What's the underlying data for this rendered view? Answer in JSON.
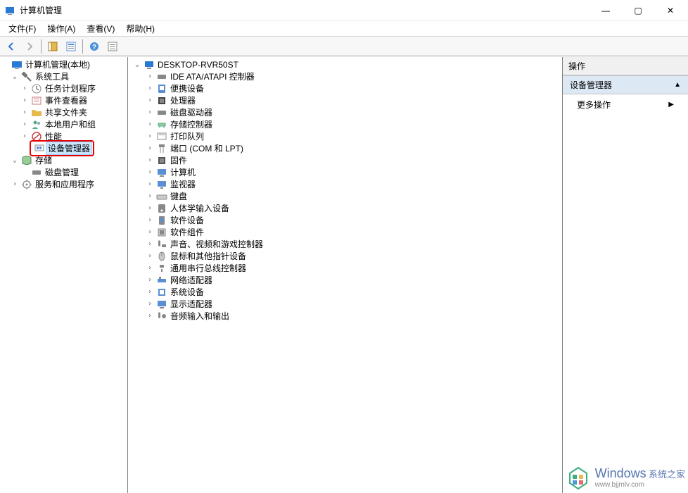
{
  "window": {
    "title": "计算机管理",
    "minimize": "—",
    "maximize": "▢",
    "close": "✕"
  },
  "menu": {
    "file": "文件(F)",
    "action": "操作(A)",
    "view": "查看(V)",
    "help": "帮助(H)"
  },
  "toolbar": {
    "back": "←",
    "forward": "→",
    "up": "⬆",
    "props": "☰",
    "refresh": "?",
    "help": "ℹ"
  },
  "left_tree": {
    "root": "计算机管理(本地)",
    "system_tools": "系统工具",
    "task_scheduler": "任务计划程序",
    "event_viewer": "事件查看器",
    "shared_folders": "共享文件夹",
    "local_users": "本地用户和组",
    "performance": "性能",
    "device_manager": "设备管理器",
    "storage": "存储",
    "disk_management": "磁盘管理",
    "services": "服务和应用程序"
  },
  "mid_tree": {
    "root": "DESKTOP-RVR50ST",
    "items": [
      {
        "label": "IDE ATA/ATAPI 控制器"
      },
      {
        "label": "便携设备"
      },
      {
        "label": "处理器"
      },
      {
        "label": "磁盘驱动器"
      },
      {
        "label": "存储控制器"
      },
      {
        "label": "打印队列"
      },
      {
        "label": "端口 (COM 和 LPT)"
      },
      {
        "label": "固件"
      },
      {
        "label": "计算机"
      },
      {
        "label": "监视器"
      },
      {
        "label": "键盘"
      },
      {
        "label": "人体学输入设备"
      },
      {
        "label": "软件设备"
      },
      {
        "label": "软件组件"
      },
      {
        "label": "声音、视频和游戏控制器"
      },
      {
        "label": "鼠标和其他指针设备"
      },
      {
        "label": "通用串行总线控制器"
      },
      {
        "label": "网络适配器"
      },
      {
        "label": "系统设备"
      },
      {
        "label": "显示适配器"
      },
      {
        "label": "音频输入和输出"
      }
    ]
  },
  "right_pane": {
    "header": "操作",
    "section": "设备管理器",
    "more_actions": "更多操作"
  },
  "watermark": {
    "brand": "Windows",
    "brand_sub": "系统之家",
    "url": "www.bjjmlv.com"
  }
}
